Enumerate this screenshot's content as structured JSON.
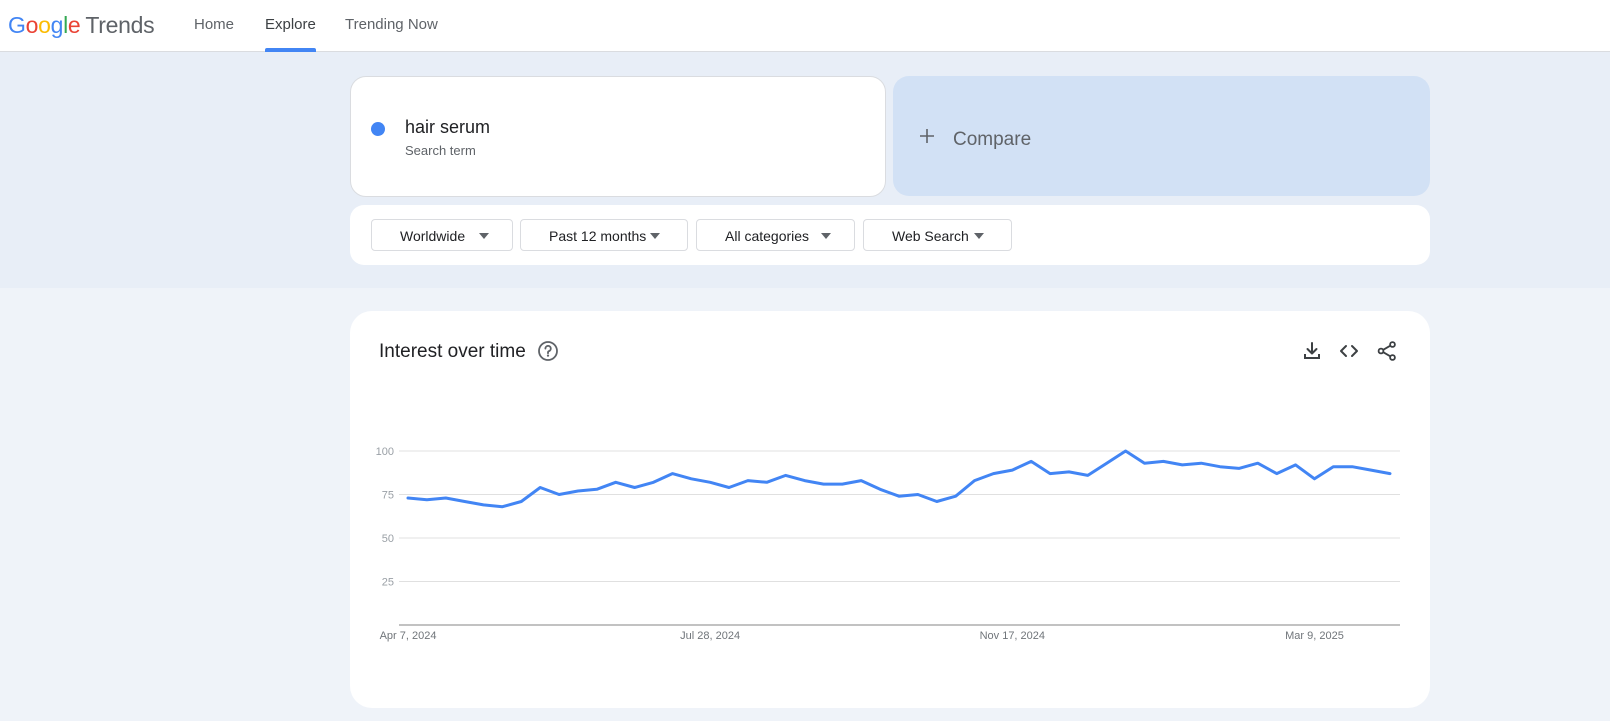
{
  "app": {
    "logo_letters": [
      "G",
      "o",
      "o",
      "g",
      "l",
      "e"
    ],
    "logo_product": "Trends"
  },
  "nav": {
    "items": [
      {
        "label": "Home"
      },
      {
        "label": "Explore",
        "active": true
      },
      {
        "label": "Trending Now"
      }
    ]
  },
  "search": {
    "term": "hair serum",
    "term_type": "Search term",
    "term_color": "#4285f4",
    "compare_label": "Compare",
    "compare_icon": "plus-icon"
  },
  "filters": [
    {
      "label": "Worldwide"
    },
    {
      "label": "Past 12 months"
    },
    {
      "label": "All categories"
    },
    {
      "label": "Web Search"
    }
  ],
  "panel": {
    "title": "Interest over time",
    "help_icon": "help-circle-icon",
    "actions": [
      "download-icon",
      "embed-code-icon",
      "share-icon"
    ]
  },
  "chart_data": {
    "type": "line",
    "title": "Interest over time",
    "ylim": [
      0,
      100
    ],
    "yticks": [
      25,
      50,
      75,
      100
    ],
    "x_tick_labels": [
      "Apr 7, 2024",
      "Jul 28, 2024",
      "Nov 17, 2024",
      "Mar 9, 2025"
    ],
    "x_tick_indices": [
      0,
      16,
      32,
      48
    ],
    "grid": true,
    "series": [
      {
        "color": "#4285f4",
        "values": [
          73,
          72,
          73,
          71,
          69,
          68,
          71,
          79,
          75,
          77,
          78,
          82,
          79,
          82,
          87,
          84,
          82,
          79,
          83,
          82,
          86,
          83,
          81,
          81,
          83,
          78,
          74,
          75,
          71,
          74,
          83,
          87,
          89,
          94,
          87,
          88,
          86,
          93,
          100,
          93,
          94,
          92,
          93,
          91,
          90,
          93,
          87,
          92,
          84,
          91,
          91,
          89,
          87
        ]
      }
    ]
  }
}
